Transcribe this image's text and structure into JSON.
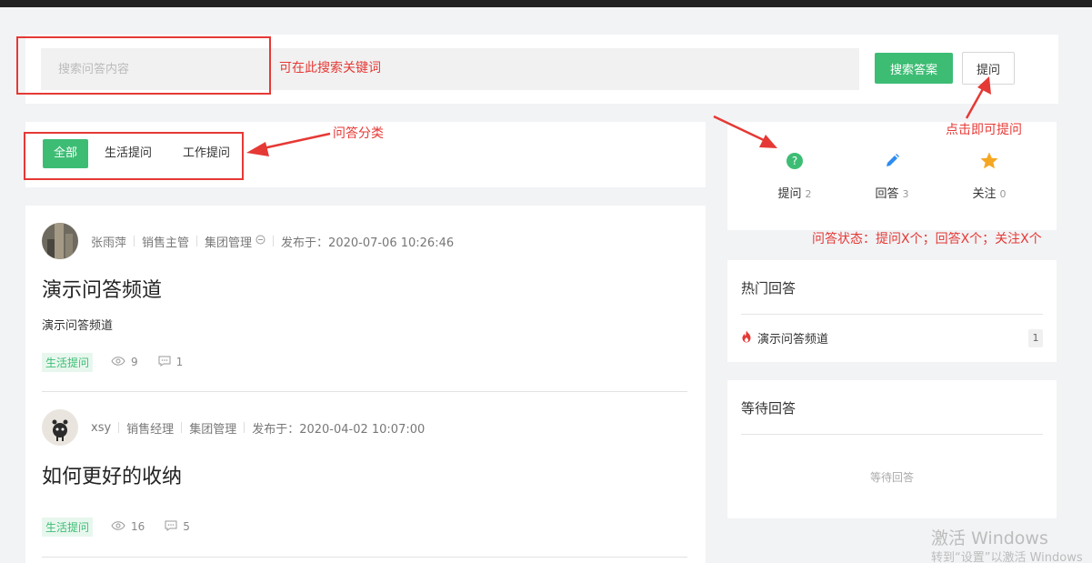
{
  "search": {
    "placeholder": "搜索问答内容",
    "search_button": "搜索答案",
    "ask_button": "提问"
  },
  "categories": {
    "tabs": [
      {
        "label": "全部",
        "active": true
      },
      {
        "label": "生活提问",
        "active": false
      },
      {
        "label": "工作提问",
        "active": false
      }
    ]
  },
  "stats": {
    "items": [
      {
        "label": "提问",
        "count": "2",
        "icon": "question-circle-icon",
        "color": "#3dbd74"
      },
      {
        "label": "回答",
        "count": "3",
        "icon": "pencil-icon",
        "color": "#2d8cf0"
      },
      {
        "label": "关注",
        "count": "0",
        "icon": "star-icon",
        "color": "#f5a623"
      }
    ]
  },
  "hot": {
    "title": "热门回答",
    "items": [
      {
        "label": "演示问答频道",
        "count": "1",
        "icon": "fire-icon"
      }
    ]
  },
  "waiting": {
    "title": "等待回答",
    "empty": "等待回答"
  },
  "questions": [
    {
      "author": "张雨萍",
      "role": "销售主管",
      "department": "集团管理",
      "published": "发布于：2020-07-06 10:26:46",
      "title": "演示问答频道",
      "description": "演示问答频道",
      "tag": "生活提问",
      "views": "9",
      "comments": "1"
    },
    {
      "author": "xsy",
      "role": "销售经理",
      "department": "集团管理",
      "published": "发布于：2020-04-02 10:07:00",
      "title": "如何更好的收纳",
      "description": "",
      "tag": "生活提问",
      "views": "16",
      "comments": "5"
    }
  ],
  "annotations": {
    "search_note": "可在此搜索关键词",
    "category_note": "问答分类",
    "ask_note": "点击即可提问",
    "status_note": "问答状态：提问X个；回答X个；关注X个"
  },
  "watermark": {
    "line1": "激活 Windows",
    "line2": "转到“设置”以激活 Windows"
  },
  "colors": {
    "accent": "#3dbd74",
    "annotation": "#e53935"
  }
}
